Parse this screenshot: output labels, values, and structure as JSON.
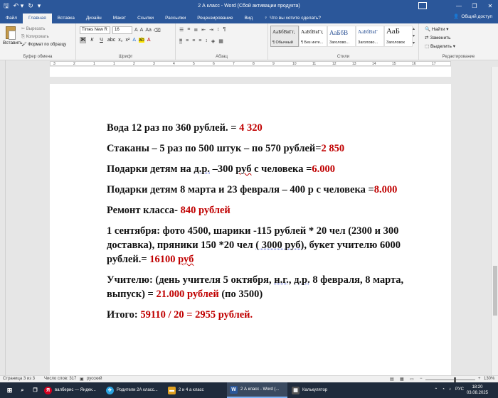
{
  "titlebar": {
    "title": "2 А класс - Word (Сбой активации продукта)",
    "qat_icons": [
      "save-icon",
      "undo-icon",
      "redo-icon",
      "customize-icon"
    ],
    "minimize": "—",
    "restore": "❐",
    "close": "✕"
  },
  "tabs": [
    "Файл",
    "Главная",
    "Вставка",
    "Дизайн",
    "Макет",
    "Ссылки",
    "Рассылки",
    "Рецензирование",
    "Вид"
  ],
  "active_tab": "Главная",
  "tell_me": "Что вы хотите сделать?",
  "share": "Общий доступ",
  "ribbon": {
    "clipboard": {
      "paste": "Вставить",
      "cut": "Вырезать",
      "copy": "Копировать",
      "format_painter": "Формат по образцу",
      "group_name": "Буфер обмена"
    },
    "font": {
      "font_name": "Times New R",
      "font_size": "16",
      "group_name": "Шрифт"
    },
    "paragraph": {
      "group_name": "Абзац"
    },
    "styles": {
      "group_name": "Стили",
      "items": [
        {
          "sample": "АаБбВвГг,",
          "name": "¶ Обычный"
        },
        {
          "sample": "АаБбВвГг,",
          "name": "¶ Без инте..."
        },
        {
          "sample": "АаБбВ",
          "name": "Заголово..."
        },
        {
          "sample": "АаБбВвГ",
          "name": "Заголово..."
        },
        {
          "sample": "АаБ",
          "name": "Заголовок"
        }
      ]
    },
    "editing": {
      "find": "Найти",
      "replace": "Заменить",
      "select": "Выделить",
      "group_name": "Редактирование"
    }
  },
  "ruler": {
    "ticks": [
      "3",
      "2",
      "1",
      "1",
      "2",
      "3",
      "4",
      "5",
      "6",
      "7",
      "8",
      "9",
      "10",
      "11",
      "12",
      "13",
      "14",
      "15",
      "16",
      "17"
    ]
  },
  "document": {
    "p1": {
      "text": "Вода 12 раз по 360 рублей. = ",
      "value": "4 320"
    },
    "p2": {
      "text": "Стаканы – 5 раз по 500 штук – по 570 рублей=",
      "value": "2 850"
    },
    "p3": {
      "a": "Подарки детям на ",
      "b": "д.р.",
      "c": " –300 ",
      "d": "руб",
      "e": " с человека =",
      "value": "6.000"
    },
    "p4": {
      "text": "Подарки детям 8 марта и 23 февраля – 400 р с человека =",
      "value": "8.000"
    },
    "p5": {
      "text": "Ремонт класса- ",
      "value": "840 рублей"
    },
    "p6": {
      "a": "1 сентября: фото 4500, шарики -115 рублей * 20 чел (2300 и 300 доставка), пряники 150 *20 чел ",
      "b": "( 3000 руб)",
      "c": ", букет учителю 6000 рублей.= ",
      "value": "16100 ",
      "d": "руб"
    },
    "p7": {
      "a": "Учителю: (день учителя 5 октября, ",
      "b": "н.г.",
      "c": ", ",
      "d": "д.р.",
      "e": " 8 февраля, 8 марта, выпуск) = ",
      "value": "21.000 рублей",
      "f": " (по 3500)"
    },
    "p8": {
      "a": "Итого: ",
      "value": "59110 / 20 = 2955 рублей."
    }
  },
  "statusbar": {
    "page": "Страница 3 из 3",
    "words": "Число слов: 317",
    "language": "русский",
    "zoom": "130%"
  },
  "taskbar": {
    "items": [
      {
        "icon": "Я",
        "label": "валберис — Яндек...",
        "color": "#d4001f"
      },
      {
        "icon": "✈",
        "label": "Родители 2А класс...",
        "color": "#2aa3e0"
      },
      {
        "icon": "▬",
        "label": "2 и 4  а класс",
        "color": "#e0a020"
      },
      {
        "icon": "W",
        "label": "2 А класс - Word (...",
        "color": "#2b579a"
      },
      {
        "icon": "▦",
        "label": "Калькулятор",
        "color": "#555555"
      }
    ],
    "lang": "РУС",
    "time": "18:20",
    "date": "03.08.2025"
  }
}
